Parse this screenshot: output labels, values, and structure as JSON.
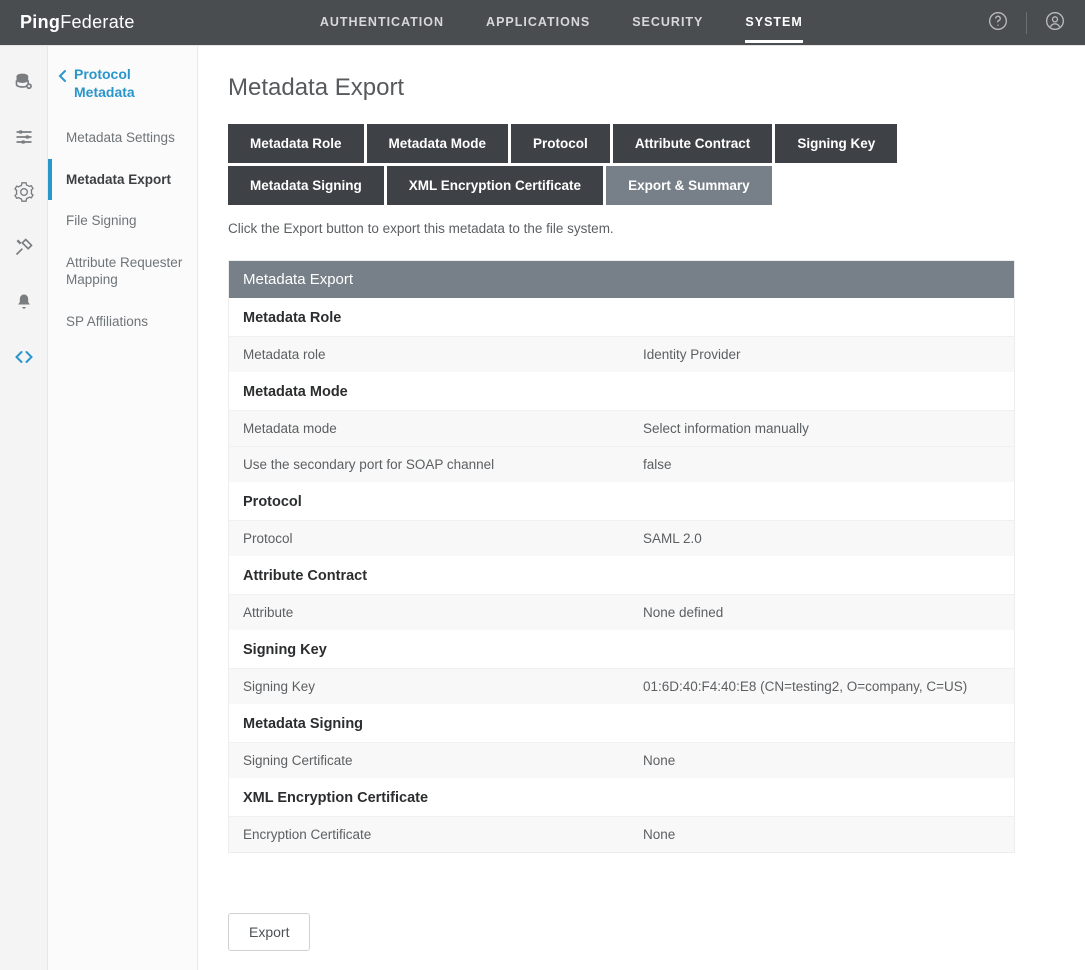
{
  "brand": {
    "bold": "Ping",
    "light": "Federate"
  },
  "topnav": {
    "items": [
      "AUTHENTICATION",
      "APPLICATIONS",
      "SECURITY",
      "SYSTEM"
    ],
    "active_index": 3
  },
  "sidebar": {
    "crumb": "Protocol Metadata",
    "items": [
      "Metadata Settings",
      "Metadata Export",
      "File Signing",
      "Attribute Requester Mapping",
      "SP Affiliations"
    ],
    "active_index": 1
  },
  "page": {
    "title": "Metadata Export",
    "instruction": "Click the Export button to export this metadata to the file system."
  },
  "wizard": {
    "tabs": [
      "Metadata Role",
      "Metadata Mode",
      "Protocol",
      "Attribute Contract",
      "Signing Key",
      "Metadata Signing",
      "XML Encryption Certificate",
      "Export & Summary"
    ],
    "active_index": 7
  },
  "summary": {
    "banner": "Metadata Export",
    "sections": [
      {
        "title": "Metadata Role",
        "rows": [
          {
            "k": "Metadata role",
            "v": "Identity Provider"
          }
        ]
      },
      {
        "title": "Metadata Mode",
        "rows": [
          {
            "k": "Metadata mode",
            "v": "Select information manually"
          },
          {
            "k": "Use the secondary port for SOAP channel",
            "v": "false"
          }
        ]
      },
      {
        "title": "Protocol",
        "rows": [
          {
            "k": "Protocol",
            "v": "SAML 2.0"
          }
        ]
      },
      {
        "title": "Attribute Contract",
        "rows": [
          {
            "k": "Attribute",
            "v": "None defined"
          }
        ]
      },
      {
        "title": "Signing Key",
        "rows": [
          {
            "k": "Signing Key",
            "v": "01:6D:40:F4:40:E8 (CN=testing2, O=company, C=US)"
          }
        ]
      },
      {
        "title": "Metadata Signing",
        "rows": [
          {
            "k": "Signing Certificate",
            "v": "None"
          }
        ]
      },
      {
        "title": "XML Encryption Certificate",
        "rows": [
          {
            "k": "Encryption Certificate",
            "v": "None"
          }
        ]
      }
    ]
  },
  "actions": {
    "export": "Export"
  }
}
